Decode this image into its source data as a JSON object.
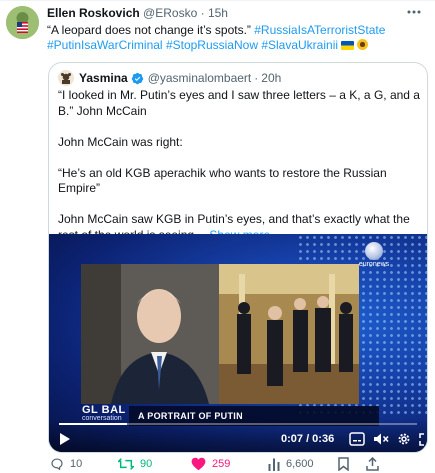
{
  "tweet": {
    "author_name": "Ellen Roskovich",
    "author_handle": "@ERosko",
    "separator": "·",
    "time": "15h",
    "text_quote": "“A leopard does not change it’s spots.”",
    "hashtags_line1": [
      "#RussiaIsATerroristState"
    ],
    "hashtags_line2": [
      "#PutinIsaWarCriminal",
      "#StopRussiaNow",
      "#SlavaUkrainii"
    ]
  },
  "quoted": {
    "author_name": "Yasmina",
    "author_handle": "@yasminalombaert",
    "separator": "·",
    "time": "20h",
    "paragraphs": [
      "“I looked in Mr. Putin’s eyes and I saw three letters – a K, a G, and a B.” John McCain",
      "John McCain was right:",
      "“He’s an old KGB aperachik who wants to restore the Russian Empire”",
      "John McCain saw KGB in Putin’s eyes, and that’s exactly what the rest of the world is seeing…"
    ],
    "show_more": "Show more",
    "video": {
      "logo": "GL BAL",
      "logo_sub": "conversation",
      "caption": "A PORTRAIT OF PUTIN",
      "channel": "euronews",
      "time_readout": "0:07 / 0:36",
      "progress": 0.19
    }
  },
  "actions": {
    "replies": "10",
    "retweets": "90",
    "likes": "259",
    "views": "6,600"
  },
  "colors": {
    "link": "#1d9bf0",
    "retweet": "#00ba7c",
    "like": "#f91880",
    "muted": "#536471"
  }
}
